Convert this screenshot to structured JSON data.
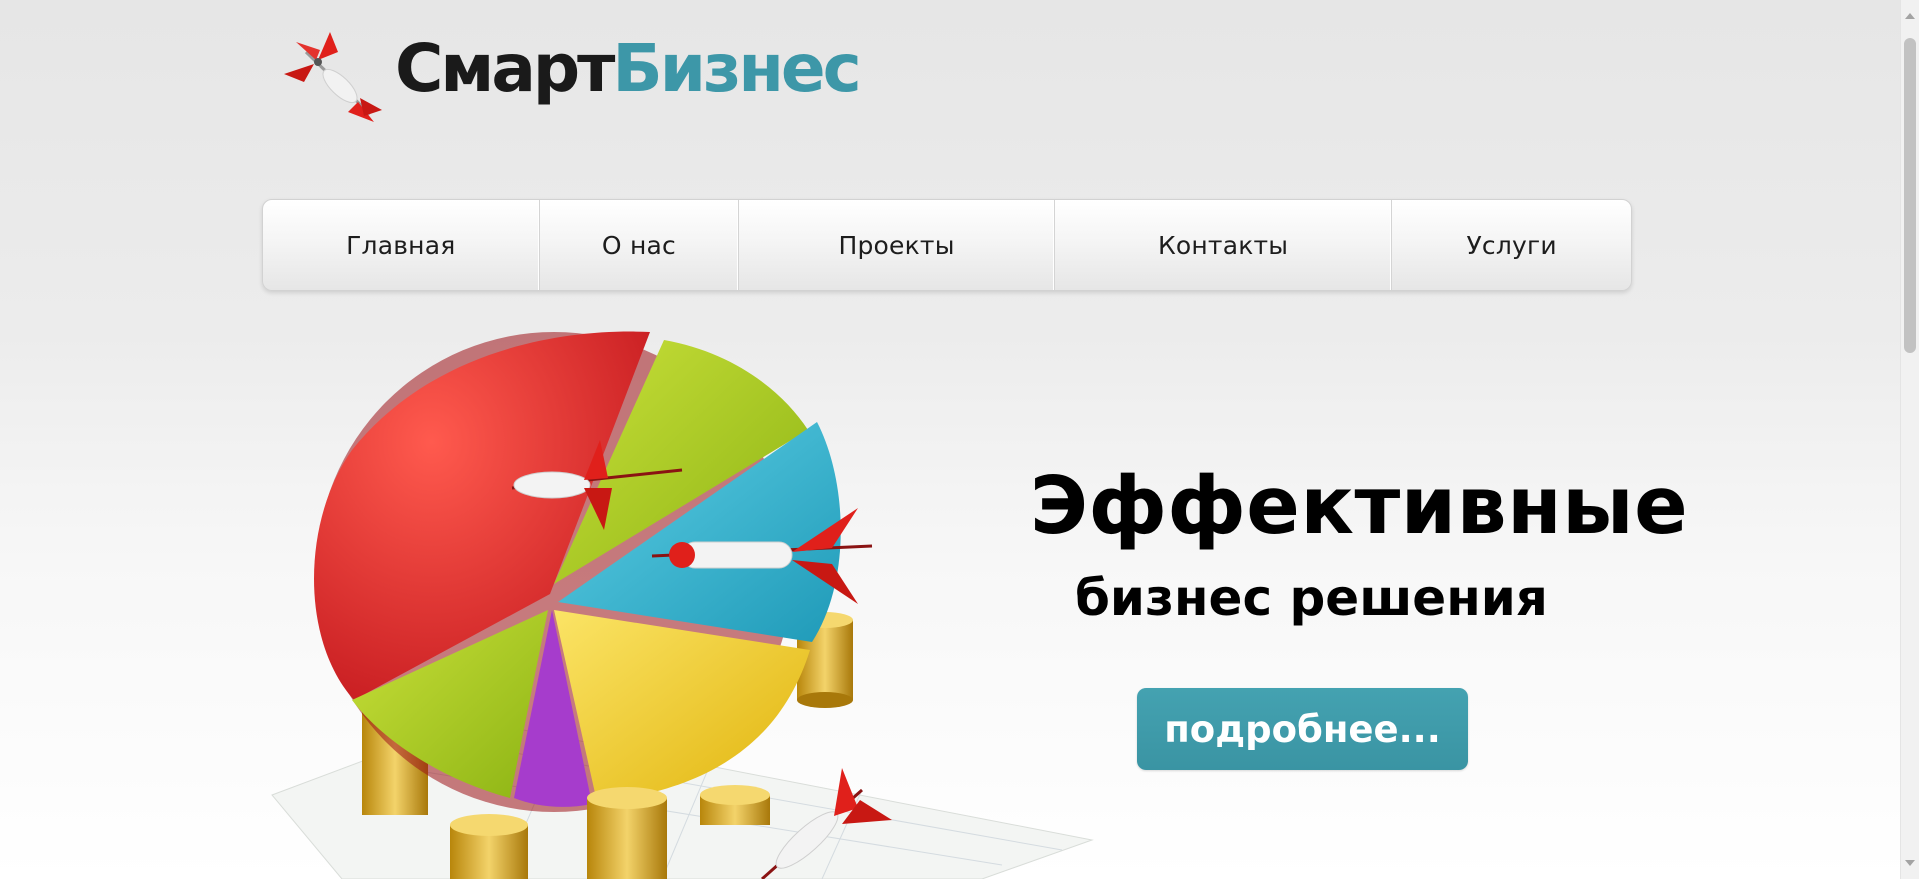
{
  "logo": {
    "part1": "Смарт",
    "part2": "Бизнес",
    "icon": "dart-icon",
    "colors": {
      "dark": "#1a1a1a",
      "accent": "#3d97a8",
      "dart": "#e0201b"
    }
  },
  "nav": {
    "items": [
      {
        "label": "Главная"
      },
      {
        "label": "О нас"
      },
      {
        "label": "Проекты"
      },
      {
        "label": "Контакты"
      },
      {
        "label": "Услуги"
      }
    ]
  },
  "hero": {
    "image": "pie-chart-darts-coins-illustration",
    "headline": "Эффективные",
    "subheadline": "бизнес решения",
    "button_label": "подробнее...",
    "button_color": "#3d9aa9",
    "pie_colors": [
      "#d9262a",
      "#a5c81c",
      "#2eb0cb",
      "#f0cb22",
      "#a63ccc"
    ]
  }
}
